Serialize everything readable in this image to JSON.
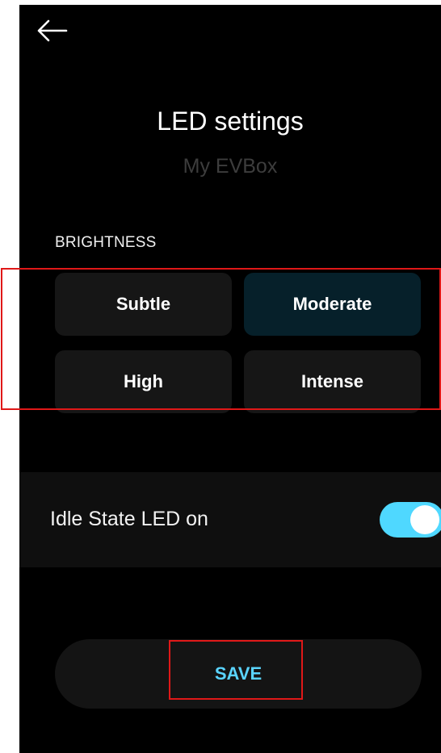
{
  "header": {
    "back_icon": "arrow-left-icon",
    "title": "LED settings",
    "subtitle": "My EVBox"
  },
  "brightness": {
    "label": "BRIGHTNESS",
    "options": [
      {
        "label": "Subtle",
        "selected": false
      },
      {
        "label": "Moderate",
        "selected": true
      },
      {
        "label": "High",
        "selected": false
      },
      {
        "label": "Intense",
        "selected": false
      }
    ]
  },
  "idle_state": {
    "label": "Idle State LED on",
    "enabled": true
  },
  "save": {
    "label": "SAVE"
  },
  "colors": {
    "background": "#000000",
    "accent": "#4fd8ff",
    "selected_option": "#06202a",
    "annotation": "#e01818"
  }
}
